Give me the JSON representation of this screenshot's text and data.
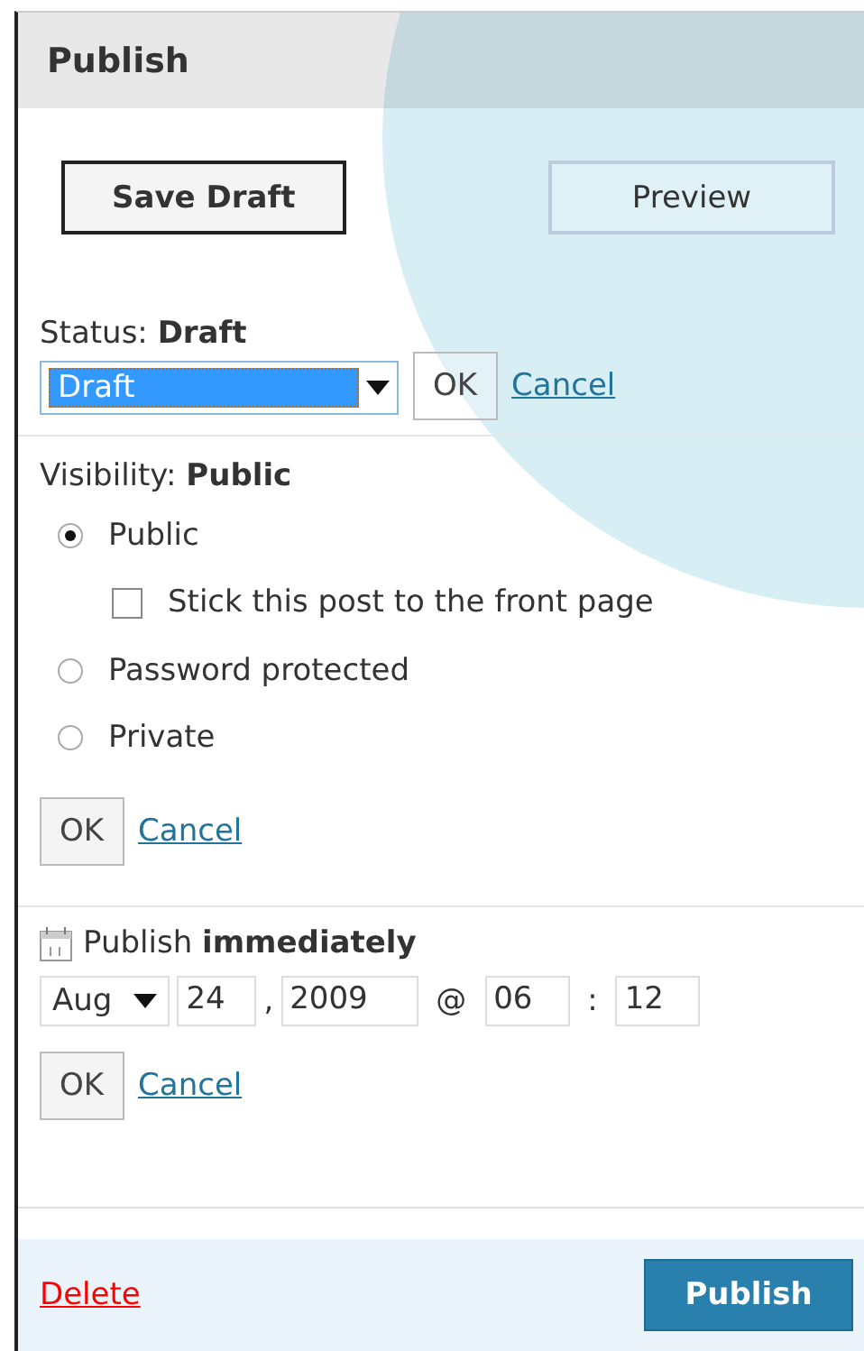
{
  "header": {
    "title": "Publish"
  },
  "actions": {
    "save_draft": "Save Draft",
    "preview": "Preview"
  },
  "status": {
    "label": "Status:",
    "value": "Draft",
    "select": "Draft",
    "ok": "OK",
    "cancel": "Cancel"
  },
  "visibility": {
    "label": "Visibility:",
    "value": "Public",
    "options": [
      {
        "kind": "radio",
        "label": "Public",
        "selected": true
      },
      {
        "kind": "checkbox",
        "label": "Stick this post to the front page",
        "checked": false
      },
      {
        "kind": "radio",
        "label": "Password protected",
        "selected": false
      },
      {
        "kind": "radio",
        "label": "Private",
        "selected": false
      }
    ],
    "ok": "OK",
    "cancel": "Cancel"
  },
  "schedule": {
    "text": "Publish **immediately**",
    "month": "Aug",
    "day": "24",
    "comma": ",",
    "year": "2009",
    "at": "@",
    "hour": "06",
    "colon": ":",
    "minute": "12",
    "ok": "OK",
    "cancel": "Cancel"
  },
  "footer": {
    "delete": "Delete",
    "publish": "Publish"
  }
}
